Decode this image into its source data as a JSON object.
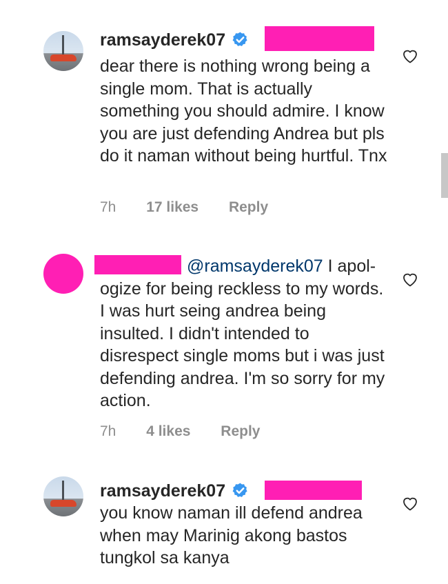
{
  "comments": [
    {
      "username": "ramsayderek07",
      "verified": true,
      "text": "dear there is nothing wrong being a single mom. That is actually something you should admire. I know you are just defending Andrea but pls do it naman without being hurtful. Tnx",
      "time": "7h",
      "likes": "17 likes",
      "reply": "Reply",
      "avatar": "car-photo-avatar"
    },
    {
      "username": "",
      "verified": false,
      "mention": "@ramsayderek07",
      "text": " I apol-ogize for being reckless to my words. I was hurt seing andrea being insulted. I didn't intended to disrespect single moms but i was just defending  andrea. I'm so sorry for my action.",
      "time": "7h",
      "likes": "4 likes",
      "reply": "Reply",
      "avatar": "pink-redacted-avatar"
    },
    {
      "username": "ramsayderek07",
      "verified": true,
      "text": "you know naman ill defend andrea when may Marinig akong bastos tungkol sa kanya",
      "avatar": "car-photo-avatar"
    }
  ],
  "colors": {
    "redaction": "#ff1fb4",
    "verified_badge": "#3897f0",
    "mention": "#00376b",
    "meta": "#8e8e8e"
  },
  "icons": [
    "verified-badge-icon",
    "heart-outline-icon"
  ]
}
